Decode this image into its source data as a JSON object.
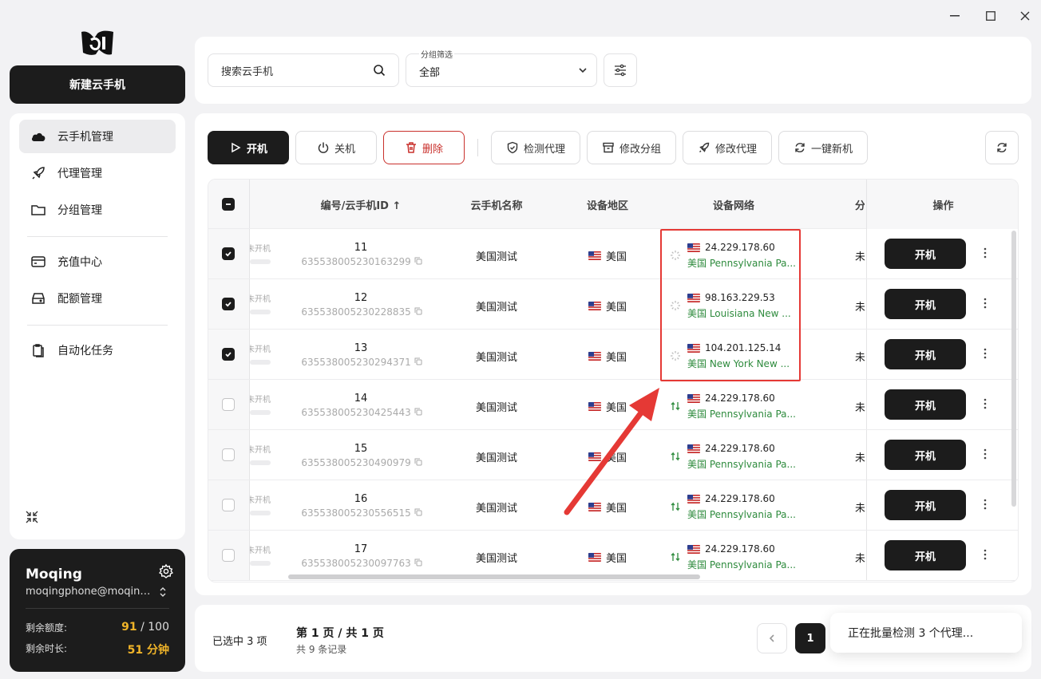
{
  "app": {
    "new_button": "新建云手机",
    "nav": [
      "云手机管理",
      "代理管理",
      "分组管理",
      "充值中心",
      "配额管理",
      "自动化任务"
    ],
    "user": {
      "name": "Moqing",
      "email": "moqingphone@moqing....",
      "quota_label": "剩余额度:",
      "quota_used": "91",
      "quota_sep": " / ",
      "quota_total": "100",
      "time_label": "剩余时长:",
      "time_value": "51",
      "time_unit": " 分钟"
    }
  },
  "filter": {
    "search_placeholder": "搜索云手机",
    "group_label": "分组筛选",
    "group_value": "全部"
  },
  "toolbar": {
    "power_on": "开机",
    "power_off": "关机",
    "delete": "删除",
    "check_proxy": "检测代理",
    "modify_group": "修改分组",
    "modify_proxy": "修改代理",
    "one_click_new": "一键新机"
  },
  "table": {
    "headers": {
      "id": "编号/云手机ID",
      "name": "云手机名称",
      "region": "设备地区",
      "network": "设备网络",
      "clip": "分",
      "actions": "操作"
    },
    "rows": [
      {
        "checked": true,
        "status": "未开机",
        "num": "11",
        "id": "635538005230163299",
        "name": "美国测试",
        "region": "美国",
        "ip": "24.229.178.60",
        "loc": "美国 Pennsylvania Pa...",
        "clip": "未",
        "action": "开机",
        "net": "loading"
      },
      {
        "checked": true,
        "status": "未开机",
        "num": "12",
        "id": "635538005230228835",
        "name": "美国测试",
        "region": "美国",
        "ip": "98.163.229.53",
        "loc": "美国 Louisiana New ...",
        "clip": "未",
        "action": "开机",
        "net": "loading"
      },
      {
        "checked": true,
        "status": "未开机",
        "num": "13",
        "id": "635538005230294371",
        "name": "美国测试",
        "region": "美国",
        "ip": "104.201.125.14",
        "loc": "美国 New York New ...",
        "clip": "未",
        "action": "开机",
        "net": "loading"
      },
      {
        "checked": false,
        "status": "未开机",
        "num": "14",
        "id": "635538005230425443",
        "name": "美国测试",
        "region": "美国",
        "ip": "24.229.178.60",
        "loc": "美国 Pennsylvania Pa...",
        "clip": "未",
        "action": "开机",
        "net": "ok"
      },
      {
        "checked": false,
        "status": "未开机",
        "num": "15",
        "id": "635538005230490979",
        "name": "美国测试",
        "region": "美国",
        "ip": "24.229.178.60",
        "loc": "美国 Pennsylvania Pa...",
        "clip": "未",
        "action": "开机",
        "net": "ok"
      },
      {
        "checked": false,
        "status": "未开机",
        "num": "16",
        "id": "635538005230556515",
        "name": "美国测试",
        "region": "美国",
        "ip": "24.229.178.60",
        "loc": "美国 Pennsylvania Pa...",
        "clip": "未",
        "action": "开机",
        "net": "ok"
      },
      {
        "checked": false,
        "status": "未开机",
        "num": "17",
        "id": "635538005230097763",
        "name": "美国测试",
        "region": "美国",
        "ip": "24.229.178.60",
        "loc": "美国 Pennsylvania Pa...",
        "clip": "未",
        "action": "开机",
        "net": "ok"
      }
    ]
  },
  "pagination": {
    "selected": "已选中 3 项",
    "page": "第 1 页 / 共 1 页",
    "total": "共 9 条记录",
    "current": "1"
  },
  "toast": "正在批量检测 3 个代理...",
  "colors": {
    "accent": "#1c1c1c",
    "danger": "#c9302c",
    "success": "#2e8b3d",
    "highlight": "#e53935",
    "gold": "#f0b429"
  }
}
